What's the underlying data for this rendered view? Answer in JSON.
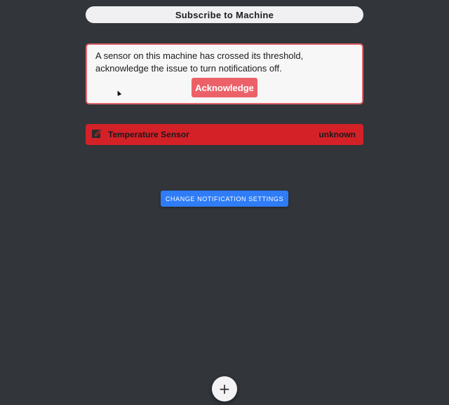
{
  "header": {
    "subscribe_label": "Subscribe to Machine"
  },
  "alert": {
    "message": "A sensor on this machine has crossed its threshold, acknowledge the issue to turn notifications off.",
    "acknowledge_label": "Acknowledge",
    "border_color": "#e0646a",
    "button_color": "#ec6168"
  },
  "sensors": [
    {
      "icon": "edit-icon",
      "name": "Temperature Sensor",
      "status": "unknown",
      "color": "#d42128"
    }
  ],
  "settings": {
    "notification_button_label": "CHANGE NOTIFICATION SETTINGS",
    "color": "#2f7cf6"
  },
  "fab": {
    "icon": "plus-icon",
    "symbol": "+"
  },
  "colors": {
    "background": "#323539"
  }
}
